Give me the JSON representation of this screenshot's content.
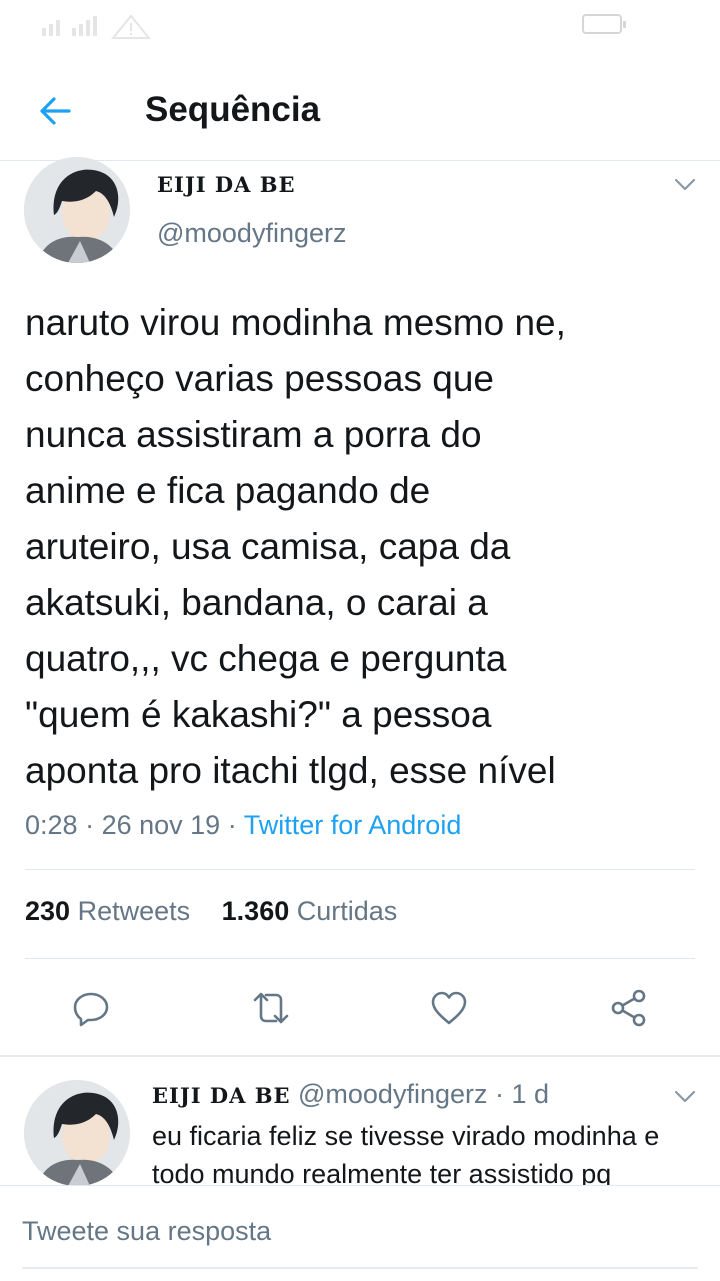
{
  "status_bar": {
    "signal_icon": "signal-icon",
    "warning_icon": "warning-icon",
    "battery_icon": "battery-icon"
  },
  "header": {
    "back_icon": "back-arrow-icon",
    "title": "Sequência"
  },
  "tweet": {
    "author_name": "EIJI DA BE",
    "author_handle": "@moodyfingerz",
    "text": "naruto virou modinha mesmo ne,\nconheço varias pessoas que\nnunca assistiram a porra do\nanime e fica pagando de\naruteiro, usa camisa, capa da\nakatsuki, bandana, o carai a\nquatro,,, vc chega e pergunta\n\"quem é kakashi?\" a pessoa\naponta pro itachi tlgd, esse nível",
    "time": "0:28",
    "date": "26 nov 19",
    "separator": "·",
    "source": "Twitter for Android",
    "retweets_count": "230",
    "retweets_label": "Retweets",
    "likes_count": "1.360",
    "likes_label": "Curtidas",
    "actions": [
      "reply-icon",
      "retweet-icon",
      "like-icon",
      "share-icon"
    ]
  },
  "reply": {
    "author_name": "EIJI DA BE",
    "author_handle": "@moodyfingerz",
    "separator": "·",
    "age": "1 d",
    "text": "eu ficaria feliz se tivesse virado modinha e todo mundo realmente ter assistido pq"
  },
  "composer": {
    "placeholder": "Tweete sua resposta"
  },
  "colors": {
    "accent": "#1da1f2",
    "secondary_text": "#657786",
    "primary_text": "#14171a",
    "divider": "#e1e8ed"
  }
}
